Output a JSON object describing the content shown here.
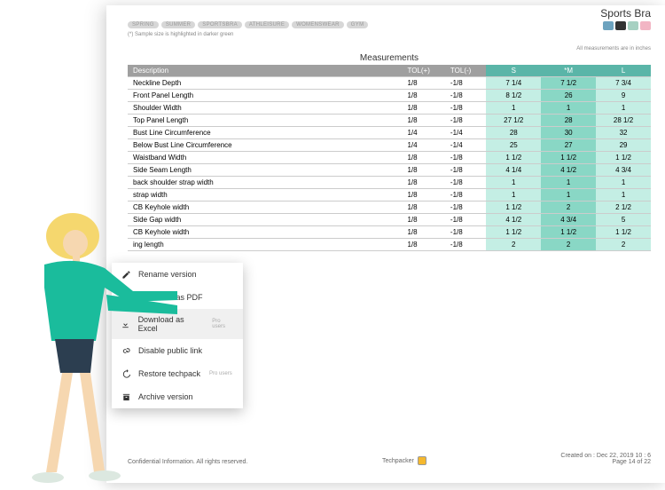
{
  "product_title": "Sports Bra",
  "tags": [
    "SPRING",
    "SUMMER",
    "SPORTSBRA",
    "ATHLEISURE",
    "WOMENSWEAR",
    "GYM"
  ],
  "sample_note": "(*) Sample size is highlighted in darker green",
  "units_note": "All measurements are in inches",
  "section_title": "Measurements",
  "columns": {
    "desc": "Description",
    "tolp": "TOL(+)",
    "tolm": "TOL(-)",
    "s": "S",
    "m": "*M",
    "l": "L"
  },
  "rows": [
    {
      "desc": "Neckline Depth",
      "tp": "1/8",
      "tm": "-1/8",
      "s": "7 1/4",
      "m": "7 1/2",
      "l": "7 3/4"
    },
    {
      "desc": "Front Panel Length",
      "tp": "1/8",
      "tm": "-1/8",
      "s": "8 1/2",
      "m": "26",
      "l": "9"
    },
    {
      "desc": "Shoulder Width",
      "tp": "1/8",
      "tm": "-1/8",
      "s": "1",
      "m": "1",
      "l": "1"
    },
    {
      "desc": "Top Panel Length",
      "tp": "1/8",
      "tm": "-1/8",
      "s": "27 1/2",
      "m": "28",
      "l": "28 1/2"
    },
    {
      "desc": "Bust Line Circumference",
      "tp": "1/4",
      "tm": "-1/4",
      "s": "28",
      "m": "30",
      "l": "32"
    },
    {
      "desc": "Below Bust Line Circumference",
      "tp": "1/4",
      "tm": "-1/4",
      "s": "25",
      "m": "27",
      "l": "29"
    },
    {
      "desc": "Waistband Width",
      "tp": "1/8",
      "tm": "-1/8",
      "s": "1 1/2",
      "m": "1 1/2",
      "l": "1 1/2"
    },
    {
      "desc": "Side Seam Length",
      "tp": "1/8",
      "tm": "-1/8",
      "s": "4 1/4",
      "m": "4 1/2",
      "l": "4 3/4"
    },
    {
      "desc": "back shoulder strap width",
      "tp": "1/8",
      "tm": "-1/8",
      "s": "1",
      "m": "1",
      "l": "1"
    },
    {
      "desc": "strap width",
      "tp": "1/8",
      "tm": "-1/8",
      "s": "1",
      "m": "1",
      "l": "1"
    },
    {
      "desc": "CB Keyhole width",
      "tp": "1/8",
      "tm": "-1/8",
      "s": "1 1/2",
      "m": "2",
      "l": "2 1/2"
    },
    {
      "desc": "Side Gap width",
      "tp": "1/8",
      "tm": "-1/8",
      "s": "4 1/2",
      "m": "4 3/4",
      "l": "5"
    },
    {
      "desc": "CB Keyhole width",
      "tp": "1/8",
      "tm": "-1/8",
      "s": "1 1/2",
      "m": "1 1/2",
      "l": "1 1/2"
    },
    {
      "desc": "ing length",
      "tp": "1/8",
      "tm": "-1/8",
      "s": "2",
      "m": "2",
      "l": "2"
    }
  ],
  "menu": {
    "rename": "Rename version",
    "pdf": "Download as PDF",
    "excel": "Download as Excel",
    "disable": "Disable public link",
    "restore": "Restore techpack",
    "archive": "Archive version",
    "pro": "Pro users"
  },
  "footer": {
    "left": "Confidential Information. All rights reserved.",
    "brand": "Techpacker",
    "created": "Created on : Dec 22, 2019 10 : 6",
    "page": "Page 14 of 22"
  }
}
